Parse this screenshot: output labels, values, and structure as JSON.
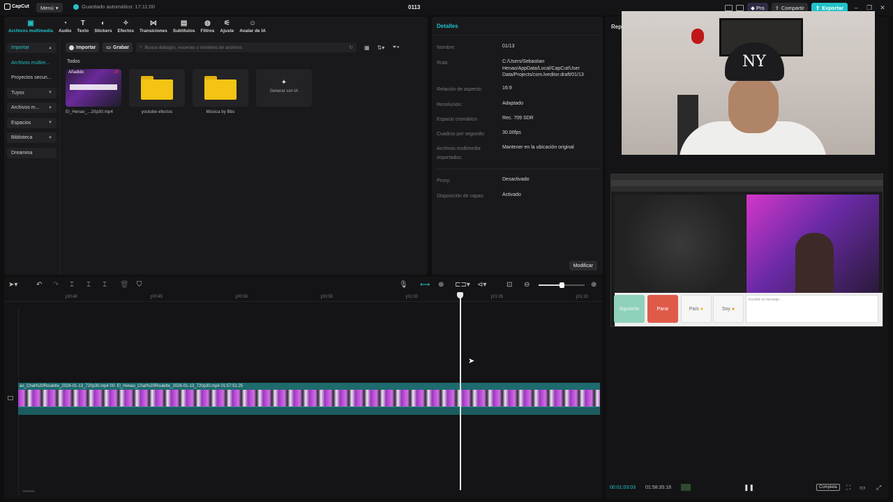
{
  "app": {
    "name": "CapCut",
    "menu_label": "Menú",
    "autosave": "Guardado automático: 17:11:00",
    "project_title": "0113",
    "pro_label": "Pro",
    "share_label": "Compartir",
    "export_label": "Exportar"
  },
  "toolbar": [
    {
      "label": "Archivos multimedia",
      "icon": "media-icon"
    },
    {
      "label": "Audio",
      "icon": "audio-icon"
    },
    {
      "label": "Texto",
      "icon": "text-icon"
    },
    {
      "label": "Stickers",
      "icon": "sticker-icon"
    },
    {
      "label": "Efectos",
      "icon": "effects-icon"
    },
    {
      "label": "Transiciones",
      "icon": "transitions-icon"
    },
    {
      "label": "Subtítulos",
      "icon": "subtitles-icon"
    },
    {
      "label": "Filtros",
      "icon": "filters-icon"
    },
    {
      "label": "Ajuste",
      "icon": "adjust-icon"
    },
    {
      "label": "Avatar de IA",
      "icon": "ai-avatar-icon"
    }
  ],
  "sidebar": [
    {
      "label": "Importar",
      "caret": "▲"
    },
    {
      "label": "Archivos multim...",
      "caret": ""
    },
    {
      "label": "Proyectos secun...",
      "caret": ""
    },
    {
      "label": "Tuyos",
      "caret": "▼"
    },
    {
      "label": "Archivos m...",
      "caret": "▼"
    },
    {
      "label": "Espacios",
      "caret": "▼"
    },
    {
      "label": "Biblioteca",
      "caret": "▼"
    },
    {
      "label": "Dreamina",
      "caret": ""
    }
  ],
  "media": {
    "import_button": "Importar",
    "record_button": "Grabar",
    "search_placeholder": "Busca diálogos, escenas o nombres de archivos",
    "section_label": "Todos",
    "items": [
      {
        "type": "video",
        "label": "El_Henao_...20p30.mp4",
        "badge": "Añadido",
        "duration": "26"
      },
      {
        "type": "folder",
        "label": "youtube efectos"
      },
      {
        "type": "folder",
        "label": "Música by Bbs"
      },
      {
        "type": "ai",
        "label": "Generar con IA"
      }
    ]
  },
  "details": {
    "title": "Detalles",
    "rows": [
      {
        "key": "Nombre:",
        "value": "01/13"
      },
      {
        "key": "Ruta:",
        "value": "C:/Users/Sebastian Henao/AppData/Local/CapCut/User Data/Projects/com.lveditor.draft/01/13"
      },
      {
        "key": "Relación de aspecto:",
        "value": "16:9"
      },
      {
        "key": "Resolución:",
        "value": "Adaptado"
      },
      {
        "key": "Espacio cromático:",
        "value": "Rec. 709 SDR"
      },
      {
        "key": "Cuadros por segundo:",
        "value": "30.00fps"
      },
      {
        "key": "Archivos multimedia importados:",
        "value": "Mantener en la ubicación original"
      },
      {
        "key": "Proxy:",
        "value": "Desactivado"
      },
      {
        "key": "Disposición de capas:",
        "value": "Activado"
      }
    ],
    "modify_button": "Modificar"
  },
  "player": {
    "label": "Rep",
    "current_time": "00:01:03:03",
    "total_time": "01:58:35:18",
    "complete_label": "Completa"
  },
  "browser": {
    "buttons": [
      "Siguiente",
      "Parar",
      "País",
      "Soy"
    ],
    "chat_placeholder": "Escribir un mensaje..."
  },
  "timeline": {
    "ticks": [
      "00:40",
      "00:45",
      "00:50",
      "00:55",
      "01:00",
      "01:05",
      "01:10"
    ],
    "clip_label": "ao_Chat%20Roulette_2026-01-13_720p30.mp4  00:  El_Henao_Chat%20Roulette_2026-01-13_720p30.mp4  01:57:51:25"
  },
  "colors": {
    "accent": "#22c2c9",
    "background": "#0f0f10",
    "panel": "#19191b"
  }
}
